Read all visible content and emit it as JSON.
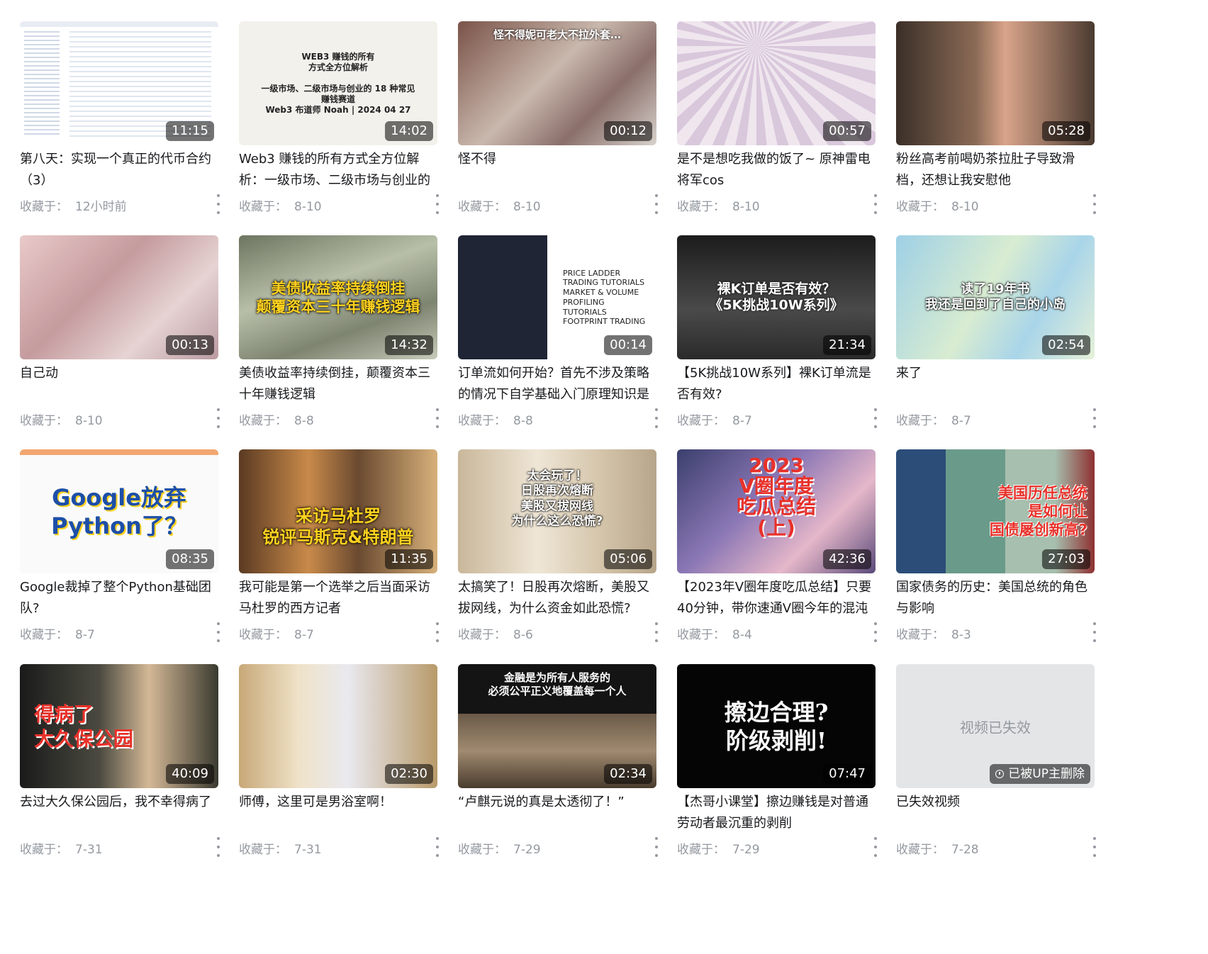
{
  "collected_label": "收藏于：",
  "colors": {
    "title": "#18191c",
    "meta": "#9499a0",
    "duration_bg": "rgba(0,0,0,0.55)"
  },
  "videos": [
    {
      "title": "第八天：实现一个真正的代币合约（3）",
      "duration": "11:15",
      "date": "12小时前",
      "thumb_text": ""
    },
    {
      "title": "Web3 赚钱的所有方式全方位解析：一级市场、二级市场与创业的",
      "duration": "14:02",
      "date": "8-10",
      "thumb_text": "WEB3 赚钱的所有\n方式全方位解析\n\n一级市场、二级市场与创业的 18 种常见\n赚钱赛道\nWeb3 布道师 Noah | 2024 04 27"
    },
    {
      "title": "怪不得",
      "duration": "00:12",
      "date": "8-10",
      "thumb_text": "怪不得妮可老大不拉外套…"
    },
    {
      "title": "是不是想吃我做的饭了~ 原神雷电将军cos",
      "duration": "00:57",
      "date": "8-10",
      "thumb_text": ""
    },
    {
      "title": "粉丝高考前喝奶茶拉肚子导致滑档，还想让我安慰他",
      "duration": "05:28",
      "date": "8-10",
      "thumb_text": ""
    },
    {
      "title": "自己动",
      "duration": "00:13",
      "date": "8-10",
      "thumb_text": ""
    },
    {
      "title": "美债收益率持续倒挂，颠覆资本三十年赚钱逻辑",
      "duration": "14:32",
      "date": "8-8",
      "thumb_text": "美债收益率持续倒挂\n颠覆资本三十年赚钱逻辑"
    },
    {
      "title": "订单流如何开始？首先不涉及策略的情况下自学基础入门原理知识是",
      "duration": "00:14",
      "date": "8-8",
      "thumb_text": "PRICE LADDER\nTRADING TUTORIALS\nMARKET & VOLUME\nPROFILING TUTORIALS\nFOOTPRINT TRADING"
    },
    {
      "title": "【5K挑战10W系列】裸K订单流是否有效?",
      "duration": "21:34",
      "date": "8-7",
      "thumb_text": "裸K订单是否有效？\n《5K挑战10W系列》"
    },
    {
      "title": "来了",
      "duration": "02:54",
      "date": "8-7",
      "thumb_text": "读了19年书\n我还是回到了自己的小岛"
    },
    {
      "title": "Google裁掉了整个Python基础团队?",
      "duration": "08:35",
      "date": "8-7",
      "thumb_text": "Google放弃\nPython了？"
    },
    {
      "title": "我可能是第一个选举之后当面采访马杜罗的西方记者",
      "duration": "11:35",
      "date": "8-7",
      "thumb_text": "采访马杜罗\n锐评马斯克&特朗普"
    },
    {
      "title": "太搞笑了！日股再次熔断，美股又拔网线，为什么资金如此恐慌?",
      "duration": "05:06",
      "date": "8-6",
      "thumb_text": "太会玩了！\n日股再次熔断\n美股又拔网线\n为什么这么恐慌?"
    },
    {
      "title": "【2023年V圈年度吃瓜总结】只要40分钟，带你速通V圈今年的混沌",
      "duration": "42:36",
      "date": "8-4",
      "thumb_text": "2023\nV圈年度\n吃瓜总结\n(上)"
    },
    {
      "title": "国家债务的历史：美国总统的角色与影响",
      "duration": "27:03",
      "date": "8-3",
      "thumb_text": "美国历任总统\n是如何让\n国债屡创新高?"
    },
    {
      "title": "去过大久保公园后，我不幸得病了",
      "duration": "40:09",
      "date": "7-31",
      "thumb_text": "得病了\n大久保公园"
    },
    {
      "title": "师傅，这里可是男浴室啊！",
      "duration": "02:30",
      "date": "7-31",
      "thumb_text": ""
    },
    {
      "title": "“卢麒元说的真是太透彻了！”",
      "duration": "02:34",
      "date": "7-29",
      "thumb_text": "金融是为所有人服务的\n必须公平正义地覆盖每一个人"
    },
    {
      "title": "【杰哥小课堂】擦边赚钱是对普通劳动者最沉重的剥削",
      "duration": "07:47",
      "date": "7-29",
      "thumb_text": "擦边合理?\n阶级剥削!"
    },
    {
      "title": "已失效视频",
      "duration": "",
      "date": "7-28",
      "thumb_text": "视频已失效",
      "badge": "已被UP主删除"
    }
  ]
}
